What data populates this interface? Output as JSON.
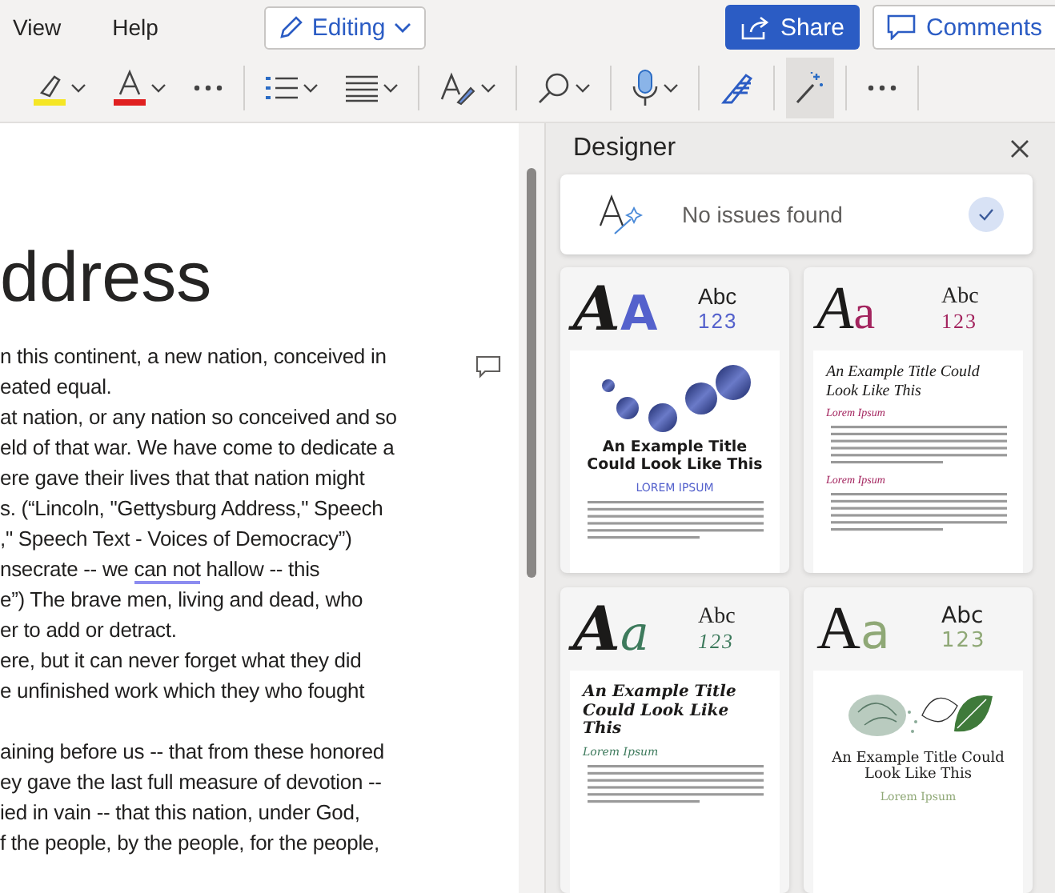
{
  "menu": [
    {
      "label": "View"
    },
    {
      "label": "Help"
    }
  ],
  "mode_button": {
    "label": "Editing"
  },
  "share_button": {
    "label": "Share"
  },
  "comments_button": {
    "label": "Comments"
  },
  "toolbar": [
    {
      "kind": "highlighter",
      "caret": true,
      "selected": false,
      "color": "#f5e625"
    },
    {
      "kind": "font-color",
      "caret": true,
      "selected": false,
      "color": "#e02020"
    },
    {
      "kind": "more",
      "caret": false,
      "selected": false
    },
    {
      "kind": "separator"
    },
    {
      "kind": "bullets",
      "caret": true,
      "selected": false
    },
    {
      "kind": "align",
      "caret": true,
      "selected": false
    },
    {
      "kind": "separator"
    },
    {
      "kind": "styles",
      "caret": true,
      "selected": false
    },
    {
      "kind": "separator"
    },
    {
      "kind": "find",
      "caret": true,
      "selected": false
    },
    {
      "kind": "separator"
    },
    {
      "kind": "dictate",
      "caret": true,
      "selected": false
    },
    {
      "kind": "separator"
    },
    {
      "kind": "editor",
      "caret": false,
      "selected": false
    },
    {
      "kind": "separator"
    },
    {
      "kind": "designer",
      "caret": false,
      "selected": true
    },
    {
      "kind": "separator"
    },
    {
      "kind": "more",
      "caret": false,
      "selected": false
    },
    {
      "kind": "separator"
    }
  ],
  "document": {
    "heading": "ddress",
    "paragraphs": [
      [
        [
          {
            "text": "n this continent, a new nation, conceived in"
          }
        ],
        [
          {
            "text": "eated equal."
          }
        ],
        [
          {
            "text": "at nation, or any nation so conceived and so"
          }
        ],
        [
          {
            "text": "eld of that war. We have come to dedicate a"
          }
        ],
        [
          {
            "text": "ere gave their lives that that nation might"
          }
        ],
        [
          {
            "text": "s. (“Lincoln, \"Gettysburg Address,\" Speech"
          }
        ],
        [
          {
            "text": ",\" Speech Text - Voices of Democracy”)"
          }
        ],
        [
          {
            "text": "nsecrate -- we "
          },
          {
            "text": "can not",
            "flagged": true
          },
          {
            "text": " hallow -- this"
          }
        ],
        [
          {
            "text": "e”) The brave men, living and dead, who"
          }
        ],
        [
          {
            "text": "er to add or detract."
          }
        ],
        [
          {
            "text": "ere, but it can never forget what they did"
          }
        ],
        [
          {
            "text": "e unfinished work which they who fought"
          }
        ]
      ],
      [
        [
          {
            "text": "aining before us -- that from these honored"
          }
        ],
        [
          {
            "text": "ey gave the last full measure of devotion --"
          }
        ],
        [
          {
            "text": "ied in vain -- that this nation, under God,"
          }
        ],
        [
          {
            "text": "f the people, by the people, for the people,"
          }
        ]
      ]
    ]
  },
  "designer": {
    "title": "Designer",
    "status": {
      "text": "No issues found",
      "checked": true
    },
    "designs": [
      {
        "color": "#5461cc",
        "glyph_1": "A",
        "glyph_2": "A",
        "sample": "Abc",
        "digits": "123",
        "preview": [
          {
            "kind": "circles"
          },
          {
            "kind": "title",
            "text": "An Example Title Could Look Like This"
          },
          {
            "kind": "subtitle",
            "text": "LOREM IPSUM"
          },
          {
            "kind": "body"
          }
        ]
      },
      {
        "color": "#a3245e",
        "glyph_1": "A",
        "glyph_2": "a",
        "sample": "Abc",
        "digits": "123",
        "preview": [
          {
            "kind": "title",
            "text": "An Example Title Could Look Like This"
          },
          {
            "kind": "subtitle",
            "text": "Lorem Ipsum"
          },
          {
            "kind": "body"
          },
          {
            "kind": "subtitle",
            "text": "Lorem Ipsum"
          },
          {
            "kind": "body"
          }
        ]
      },
      {
        "color": "#3d7a5c",
        "glyph_1": "A",
        "glyph_2": "a",
        "sample": "Abc",
        "digits": "123",
        "preview": [
          {
            "kind": "title",
            "text": "An Example Title Could Look Like This"
          },
          {
            "kind": "subtitle",
            "text": "Lorem Ipsum"
          },
          {
            "kind": "body"
          }
        ]
      },
      {
        "color": "#8fa876",
        "glyph_1": "A",
        "glyph_2": "a",
        "sample": "Abc",
        "digits": "123",
        "preview": [
          {
            "kind": "leaves"
          },
          {
            "kind": "title",
            "text": "An Example Title Could Look Like This"
          },
          {
            "kind": "subtitle",
            "text": "Lorem Ipsum"
          }
        ]
      }
    ]
  }
}
